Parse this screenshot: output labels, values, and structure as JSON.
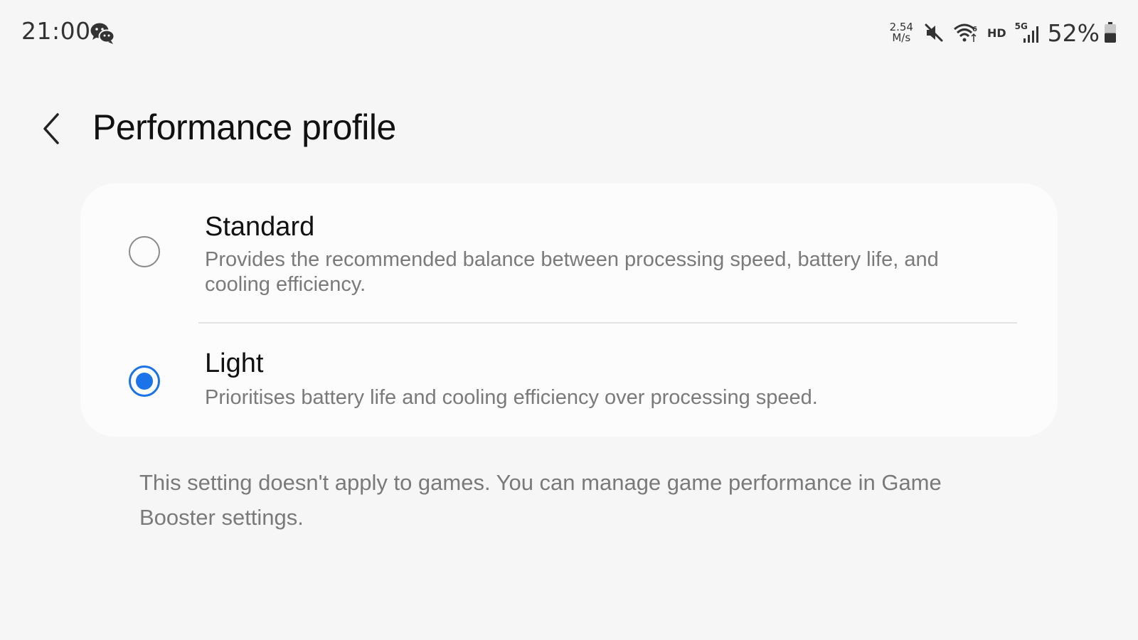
{
  "status_bar": {
    "time": "21:00",
    "speed_value": "2.54",
    "speed_unit": "M/s",
    "hd_label": "HD",
    "network_label": "5G",
    "battery_percent": "52%",
    "battery_level": 0.52,
    "icons": [
      "wechat-icon",
      "mute-icon",
      "wifi-6-icon",
      "signal-icon",
      "battery-icon"
    ]
  },
  "header": {
    "back_icon": "chevron-left-icon",
    "title": "Performance profile"
  },
  "options": [
    {
      "title": "Standard",
      "description": "Provides the recommended balance between processing speed, battery life, and cooling efficiency.",
      "selected": false
    },
    {
      "title": "Light",
      "description": "Prioritises battery life and cooling efficiency over processing speed.",
      "selected": true
    }
  ],
  "footnote": "This setting doesn't apply to games. You can manage game performance in Game Booster settings.",
  "colors": {
    "accent": "#1a73e8",
    "background": "#f6f6f6",
    "card": "#fcfcfc",
    "secondary_text": "#7a7a7a"
  }
}
